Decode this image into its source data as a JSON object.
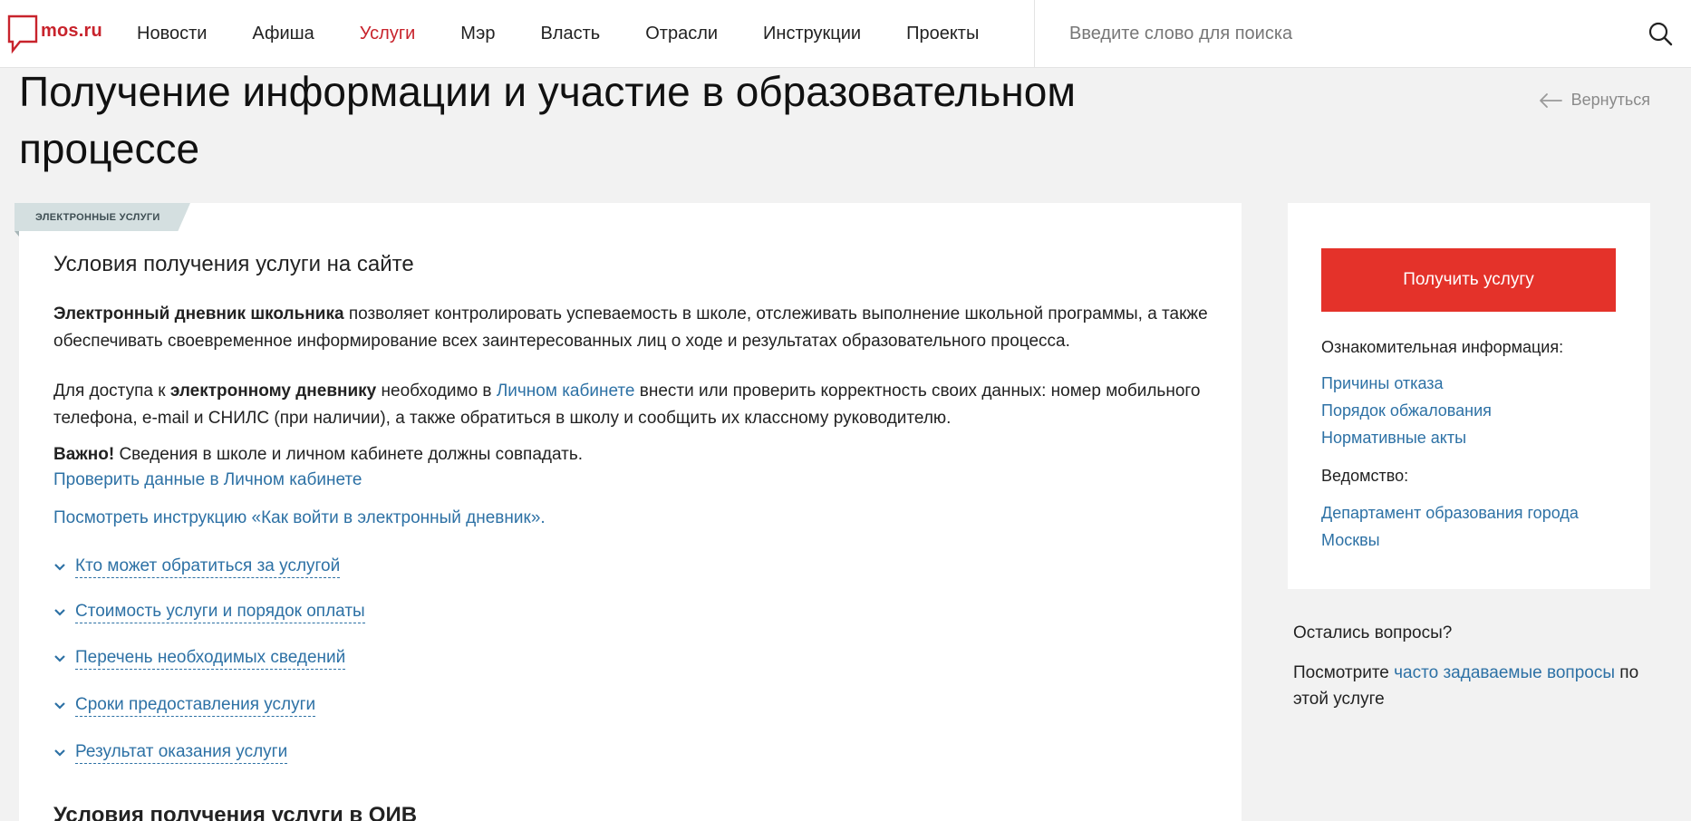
{
  "header": {
    "logo_text": "mos.ru",
    "nav": [
      "Новости",
      "Афиша",
      "Услуги",
      "Мэр",
      "Власть",
      "Отрасли",
      "Инструкции",
      "Проекты"
    ],
    "active_nav": "Услуги",
    "search_placeholder": "Введите слово для поиска"
  },
  "page": {
    "title": "Получение информации и участие в образовательном процессе",
    "back_label": "Вернуться"
  },
  "main": {
    "tag": "ЭЛЕКТРОННЫЕ УСЛУГИ",
    "section_title": "Условия получения услуги на сайте",
    "p1_bold": "Электронный дневник школьника",
    "p1_rest": " позволяет контролировать успеваемость в школе, отслеживать выполнение школьной программы, а также обеспечивать своевременное информирование всех заинтересованных лиц о ходе и результатах образовательного процесса.",
    "p2_a": "Для доступа к ",
    "p2_bold": "электронному дневнику",
    "p2_b": " необходимо в ",
    "p2_link": "Личном кабинете",
    "p2_c": " внести или проверить корректность своих данных: номер мобильного телефона, e-mail и СНИЛС (при наличии), а также обратиться в школу и сообщить их классному руководителю.",
    "important_bold": "Важно!",
    "important_text": " Сведения в школе и личном кабинете должны совпадать.",
    "check_link": "Проверить данные в Личном кабинете",
    "instruction_link": "Посмотреть инструкцию «Как войти в электронный дневник».",
    "accordion": [
      "Кто может обратиться за услугой",
      "Стоимость услуги и порядок оплаты",
      "Перечень необходимых сведений",
      "Сроки предоставления услуги",
      "Результат оказания услуги"
    ],
    "next_section_title": "Условия получения услуги в ОИВ"
  },
  "sidebar": {
    "cta_label": "Получить услугу",
    "info_label": "Ознакомительная информация:",
    "info_links": [
      "Причины отказа",
      "Порядок обжалования",
      "Нормативные акты"
    ],
    "agency_label": "Ведомство:",
    "agency_line1": "Департамент образования города",
    "agency_line2": "Москвы"
  },
  "questions": {
    "title": "Остались вопросы?",
    "text_before": "Посмотрите ",
    "link": "часто задаваемые вопросы",
    "text_after": " по этой услуге"
  },
  "colors": {
    "brand_red": "#c8232c",
    "cta_red": "#e4322a",
    "link_blue": "#2d71a5",
    "background": "#f2f2f2"
  }
}
